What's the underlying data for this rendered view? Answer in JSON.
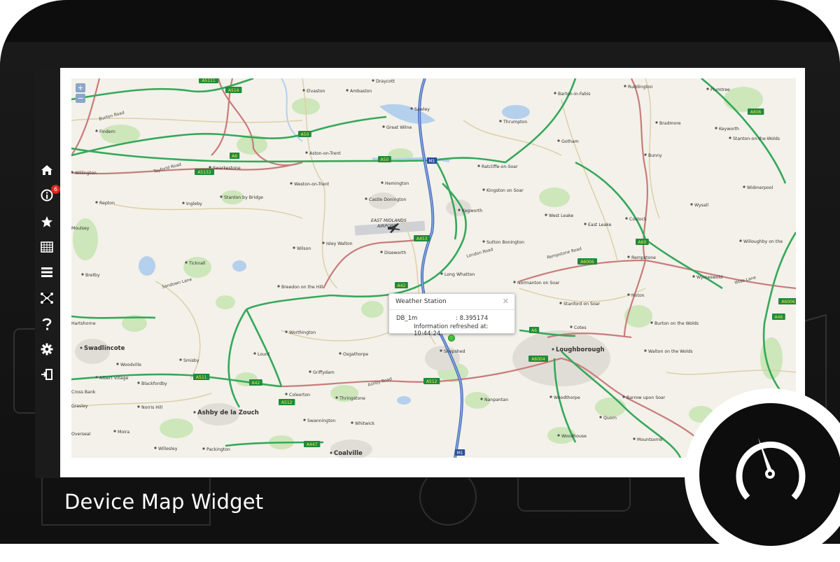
{
  "widget": {
    "caption": "Device Map Widget"
  },
  "sidebar": {
    "items": [
      {
        "icon": "home-icon"
      },
      {
        "icon": "info-icon",
        "badge": "6"
      },
      {
        "icon": "star-icon"
      },
      {
        "icon": "calendar-grid-icon"
      },
      {
        "icon": "list-icon"
      },
      {
        "icon": "network-icon"
      },
      {
        "icon": "help-icon"
      },
      {
        "icon": "gear-icon"
      },
      {
        "icon": "logout-icon"
      }
    ]
  },
  "map": {
    "zoom_in": "+",
    "zoom_out": "−",
    "places": [
      "Elvaston",
      "Ambaston",
      "Draycott",
      "Barton-in-Fabis",
      "Ruddington",
      "Plumtree",
      "Sawley",
      "Findern",
      "Thrumpton",
      "Bradmore",
      "Keyworth",
      "Great Wilne",
      "Gotham",
      "Stanton-on-the-Wolds",
      "Aston-on-Trent",
      "Bunny",
      "Willington",
      "Swarkestone",
      "Ratcliffe-on-Soar",
      "Weston-on-Trent",
      "Hemington",
      "Kingston on Soar",
      "Widmerpool",
      "Repton",
      "Castle Donington",
      "Ingleby",
      "Stanton by Bridge",
      "Kegworth",
      "Wysall",
      "West Leake",
      "East Leake",
      "Costock",
      "Wilson",
      "Sutton Bonington",
      "Willoughby on the",
      "Isley Walton",
      "Diseworth",
      "Rempstone",
      "Ticknall",
      "Bretby",
      "Long Whatton",
      "Wymeswold",
      "Breedon on the Hill",
      "Normanton on Soar",
      "Hoton",
      "Stanford on Soar",
      "Hartshorne",
      "Worthington",
      "Burton on the Wolds",
      "Cotes",
      "Swadlincote",
      "Loughborough",
      "Osgathorpe",
      "Lount",
      "Woodville",
      "Shepshed",
      "Walton on the Wolds",
      "Smisby",
      "Albert Village",
      "Griffydam",
      "Blackfordby",
      "Coleorton",
      "Thringstone",
      "Nanpantan",
      "Woodthorpe",
      "Barrow upon Soar",
      "Norris Hill",
      "Ashby de la Zouch",
      "Swannington",
      "Whitwick",
      "Quorn",
      "Overseal",
      "Moira",
      "Woodhouse",
      "Mountsorrel",
      "Willesley",
      "Packington",
      "Coalville",
      "Gresley",
      "Moulsey",
      "Cross Bank"
    ],
    "airport": [
      "EAST MIDLANDS",
      "AIRPORT"
    ],
    "roads": [
      "A5111",
      "A514",
      "A50",
      "A6",
      "A5132",
      "A50",
      "M1",
      "A453",
      "A42",
      "A6006",
      "A60",
      "A6",
      "A6004",
      "A512",
      "A511",
      "A42",
      "A512",
      "A447",
      "M1",
      "A606",
      "A6006",
      "A46",
      "Tayforld Road",
      "London Road",
      "Ashby Road",
      "Wide Lane",
      "Rempstone Road",
      "Sandown Lane",
      "Burton Road"
    ]
  },
  "popup": {
    "title": "Weather Station",
    "close": "✕",
    "sensor_key": "DB_1m",
    "sensor_value": ": 8.395174",
    "refreshed": "Information refreshed at: 10:44:24"
  },
  "colors": {
    "motorway": "#4a72c0",
    "trunk": "#35a85a",
    "aroad": "#c46b6b",
    "minor": "#d8c69a",
    "land": "#f3f1ea",
    "water": "#b4d0ec",
    "park": "#c9e5b6"
  }
}
